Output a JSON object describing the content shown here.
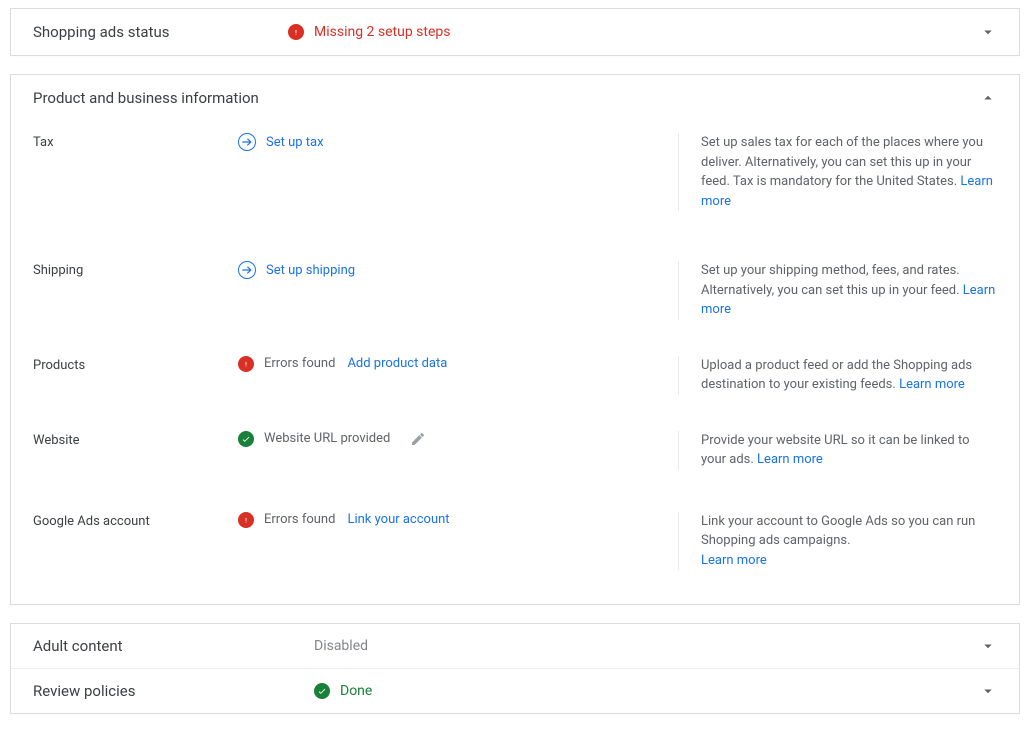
{
  "status_card": {
    "title": "Shopping ads status",
    "message": "Missing 2 setup steps"
  },
  "info_card": {
    "title": "Product and business information",
    "rows": [
      {
        "label": "Tax",
        "type": "action",
        "action": "Set up tax",
        "desc": "Set up sales tax for each of the places where you deliver. Alternatively, you can set this up in your feed. Tax is mandatory for the United States.",
        "learn": "Learn more"
      },
      {
        "label": "Shipping",
        "type": "action",
        "action": "Set up shipping",
        "desc": "Set up your shipping method, fees, and rates. Alternatively, you can set this up in your feed.",
        "learn": "Learn more"
      },
      {
        "label": "Products",
        "type": "error",
        "status": "Errors found",
        "action": "Add product data",
        "desc": "Upload a product feed or add the Shopping ads destination to your existing feeds.",
        "learn": "Learn more"
      },
      {
        "label": "Website",
        "type": "ok",
        "status": "Website URL provided",
        "desc": "Provide your website URL so it can be linked to your ads.",
        "learn": "Learn more"
      },
      {
        "label": "Google Ads account",
        "type": "error",
        "status": "Errors found",
        "action": "Link your account",
        "desc": "Link your account to Google Ads so you can run Shopping ads campaigns.",
        "learn": "Learn more"
      }
    ]
  },
  "adult": {
    "title": "Adult content",
    "status": "Disabled"
  },
  "policies": {
    "title": "Review policies",
    "status": "Done"
  }
}
